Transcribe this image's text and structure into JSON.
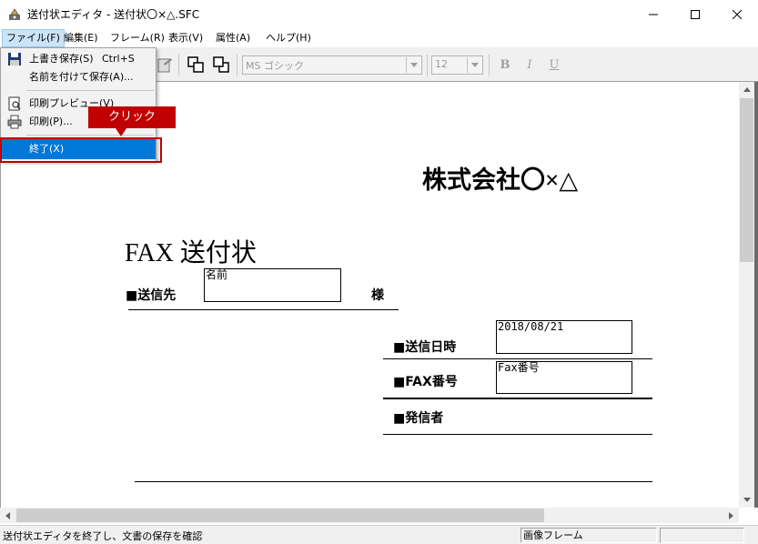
{
  "window": {
    "title": "送付状エディタ - 送付状〇×△.SFC"
  },
  "menubar": {
    "items": [
      "ファイル(F)",
      "編集(E)",
      "フレーム(R)",
      "表示(V)",
      "属性(A)",
      "ヘルプ(H)"
    ]
  },
  "toolbar": {
    "font_name": "MS ゴシック",
    "font_size": "12",
    "bold": "B",
    "italic": "I",
    "underline": "U"
  },
  "file_menu": {
    "items": [
      {
        "label": "上書き保存(S)",
        "shortcut": "Ctrl+S",
        "icon": "floppy-disk-icon"
      },
      {
        "label": "名前を付けて保存(A)...",
        "shortcut": ""
      },
      {
        "label": "印刷プレビュー(V)",
        "shortcut": "",
        "icon": "print-preview-icon"
      },
      {
        "label": "印刷(P)...",
        "shortcut": "",
        "icon": "printer-icon"
      },
      {
        "label": "終了(X)",
        "shortcut": "",
        "highlighted": true
      }
    ]
  },
  "callout": {
    "text": "クリック",
    "color": "#c00000"
  },
  "document": {
    "company": "株式会社〇×△",
    "title": "FAX 送付状",
    "recipient_label": "■送信先",
    "recipient_field": "名前",
    "honorific": "様",
    "date_label": "■送信日時",
    "date_value": "2018/08/21",
    "fax_label": "■FAX番号",
    "fax_value": "Fax番号",
    "sender_label": "■発信者"
  },
  "statusbar": {
    "message": "送付状エディタを終了し、文書の保存を確認",
    "frame_type": "画像フレーム"
  },
  "colors": {
    "selection": "#0078d7",
    "accent_red": "#c00000"
  }
}
